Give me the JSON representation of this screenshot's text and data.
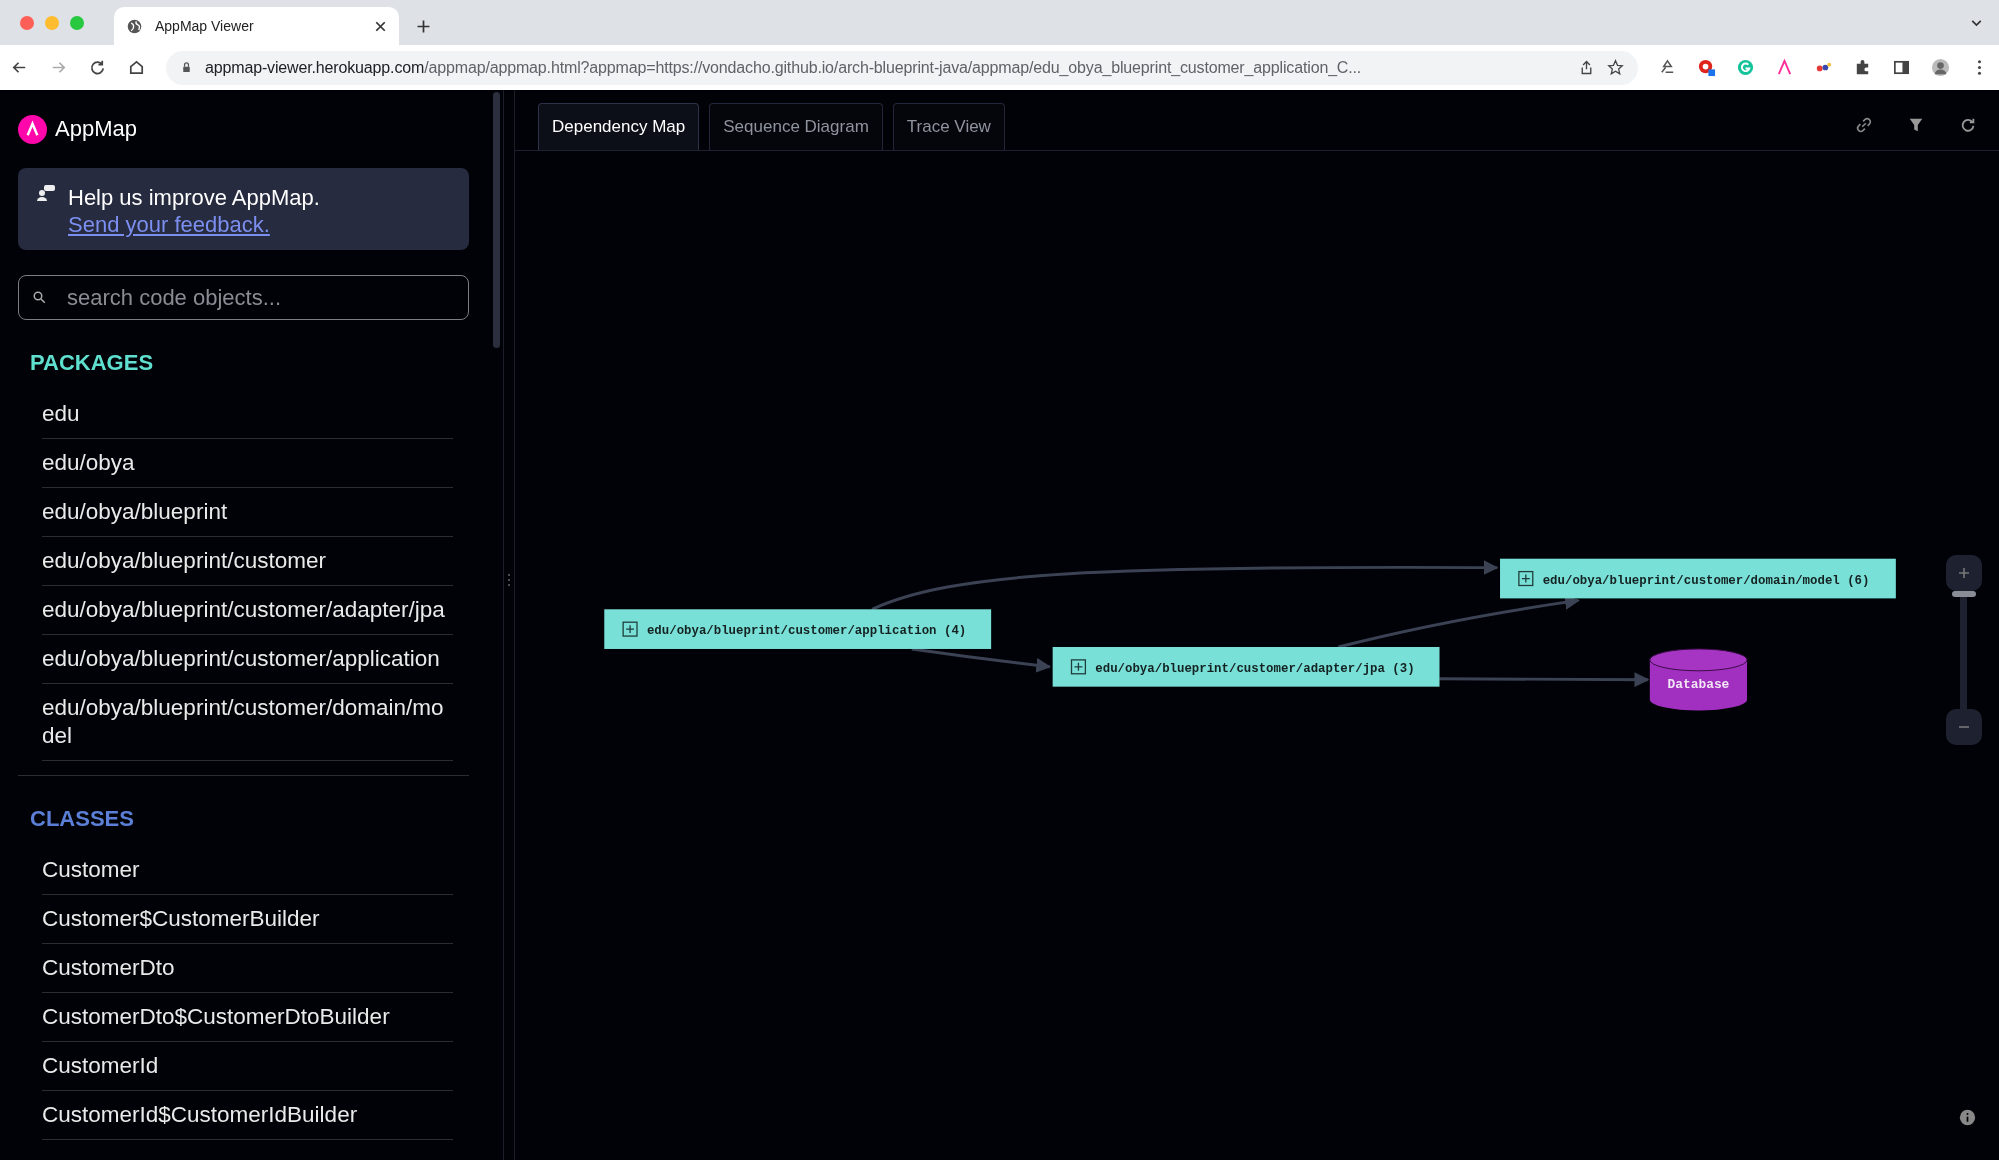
{
  "browser": {
    "tab_title": "AppMap Viewer",
    "url_host": "appmap-viewer.herokuapp.com",
    "url_path": "/appmap/appmap.html?appmap=https://vondacho.github.io/arch-blueprint-java/appmap/edu_obya_blueprint_customer_application_C..."
  },
  "sidebar": {
    "logo": "AppMap",
    "feedback": {
      "text": "Help us improve AppMap.",
      "link": "Send your feedback."
    },
    "search": {
      "placeholder": "search code objects..."
    },
    "sections": [
      {
        "title": "PACKAGES",
        "kind": "packages",
        "items": [
          "edu",
          "edu/obya",
          "edu/obya/blueprint",
          "edu/obya/blueprint/customer",
          "edu/obya/blueprint/customer/adapter/jpa",
          "edu/obya/blueprint/customer/application",
          "edu/obya/blueprint/customer/domain/model"
        ]
      },
      {
        "title": "CLASSES",
        "kind": "classes",
        "items": [
          "Customer",
          "Customer$CustomerBuilder",
          "CustomerDto",
          "CustomerDto$CustomerDtoBuilder",
          "CustomerId",
          "CustomerId$CustomerIdBuilder"
        ]
      }
    ]
  },
  "tabs": [
    {
      "label": "Dependency Map",
      "selected": true
    },
    {
      "label": "Sequence Diagram",
      "selected": false
    },
    {
      "label": "Trace View",
      "selected": false
    }
  ],
  "diagram": {
    "nodes": [
      {
        "kind": "package",
        "label": "edu/obya/blueprint/customer/application (4)"
      },
      {
        "kind": "package",
        "label": "edu/obya/blueprint/customer/adapter/jpa (3)"
      },
      {
        "kind": "package",
        "label": "edu/obya/blueprint/customer/domain/model (6)"
      },
      {
        "kind": "database",
        "label": "Database"
      }
    ],
    "zoom": {
      "level": 0.95
    }
  }
}
